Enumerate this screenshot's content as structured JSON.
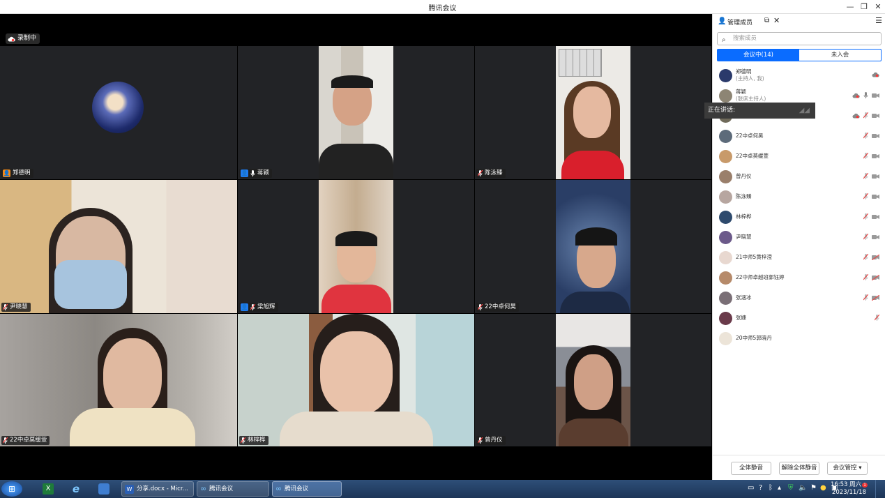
{
  "window": {
    "title": "腾讯会议"
  },
  "recording": {
    "label": "录制中"
  },
  "tiles": [
    {
      "name": "郑德明",
      "badge": "host"
    },
    {
      "name": "蒋颖",
      "badge": "cohost"
    },
    {
      "name": "陈泳臻",
      "badge": "muted"
    },
    {
      "name": "尹晓慧",
      "badge": "muted"
    },
    {
      "name": "梁旭辉",
      "badge": "cohost"
    },
    {
      "name": "22中卓何昊",
      "badge": "muted"
    },
    {
      "name": "22中卓莫缓萱",
      "badge": "muted"
    },
    {
      "name": "林梓桦",
      "badge": "muted"
    },
    {
      "name": "曾丹仪",
      "badge": "muted"
    }
  ],
  "panel": {
    "title": "管理成员",
    "search_placeholder": "搜索成员",
    "tab_in_meeting": "会议中(14)",
    "tab_not_joined": "未入会",
    "speaking_label": "正在讲话:",
    "members": [
      {
        "name": "郑德明",
        "role": "(主持人, 我)",
        "color": "#2b3a6b"
      },
      {
        "name": "蒋颖",
        "role": "(联席主持人)",
        "color": "#8d8574"
      },
      {
        "name": "",
        "role": "(联席主持人)",
        "color": "#6f6a5a"
      },
      {
        "name": "22中卓何昊",
        "role": "",
        "color": "#5d6b7a"
      },
      {
        "name": "22中卓莫缓萱",
        "role": "",
        "color": "#c89a6a"
      },
      {
        "name": "曾丹仪",
        "role": "",
        "color": "#9a7f6b"
      },
      {
        "name": "陈泳臻",
        "role": "",
        "color": "#b7a6a0"
      },
      {
        "name": "林梓桦",
        "role": "",
        "color": "#2e4a6d"
      },
      {
        "name": "尹晓慧",
        "role": "",
        "color": "#6c5a8a"
      },
      {
        "name": "21中师5黄梓滢",
        "role": "",
        "color": "#e8d8d0"
      },
      {
        "name": "22中师卓越班郭钰婷",
        "role": "",
        "color": "#b68a6a"
      },
      {
        "name": "张涵冰",
        "role": "",
        "color": "#7a6f76"
      },
      {
        "name": "张婕",
        "role": "",
        "color": "#6a3a4a"
      },
      {
        "name": "20中师5郭晓丹",
        "role": "",
        "color": "#ece4d8"
      }
    ],
    "btn_mute_all": "全体静音",
    "btn_unmute_all": "解除全体静音",
    "btn_control": "会议管控 ▾"
  },
  "taskbar": {
    "item_doc": "分享.docx - Micr...",
    "item_meeting1": "腾讯会议",
    "item_meeting2": "腾讯会议",
    "time": "16:53 周六",
    "date": "2023/11/18",
    "notif": "1"
  }
}
